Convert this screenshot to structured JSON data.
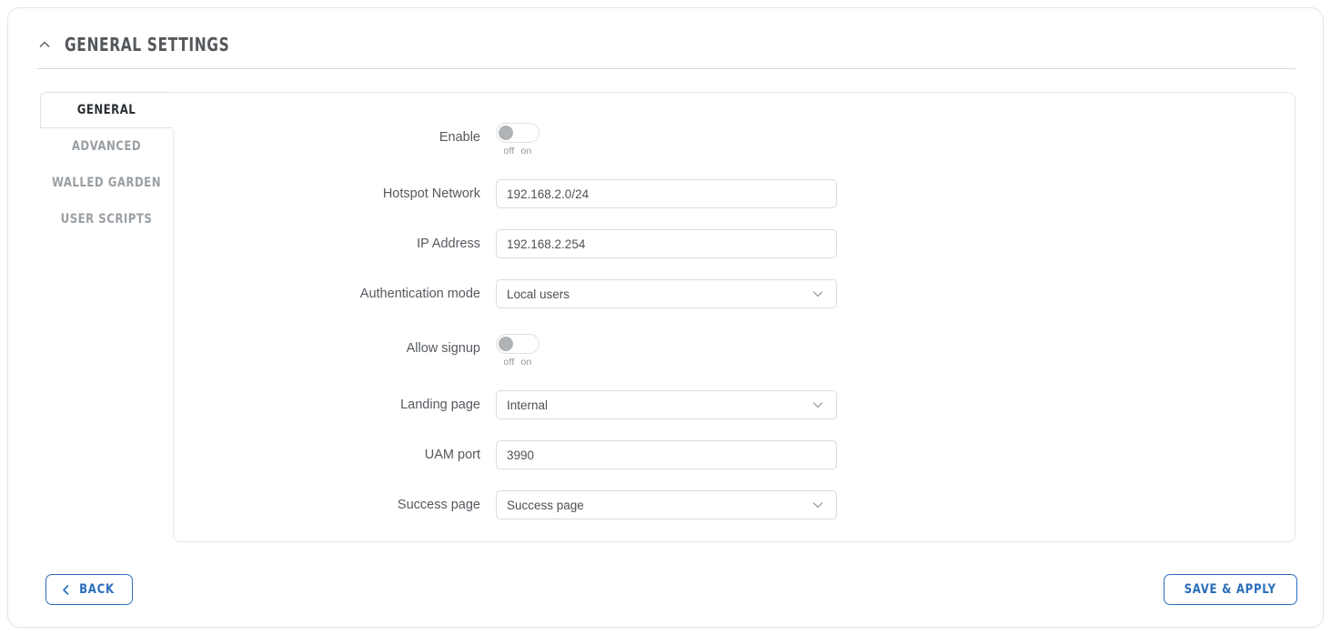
{
  "section": {
    "title": "GENERAL SETTINGS",
    "collapse_icon": "chevron-up-icon",
    "collapsed": false
  },
  "tabs": [
    {
      "label": "GENERAL",
      "active": true
    },
    {
      "label": "ADVANCED",
      "active": false
    },
    {
      "label": "WALLED GARDEN",
      "active": false
    },
    {
      "label": "USER SCRIPTS",
      "active": false
    }
  ],
  "form": {
    "enable": {
      "label": "Enable",
      "type": "toggle",
      "state": "off",
      "off_label": "off",
      "on_label": "on"
    },
    "hotspot_network": {
      "label": "Hotspot Network",
      "type": "text",
      "value": "192.168.2.0/24",
      "placeholder": ""
    },
    "ip_address": {
      "label": "IP Address",
      "type": "text",
      "value": "192.168.2.254",
      "placeholder": ""
    },
    "authentication_mode": {
      "label": "Authentication mode",
      "type": "select",
      "value": "Local users",
      "icon": "chevron-down-icon"
    },
    "allow_signup": {
      "label": "Allow signup",
      "type": "toggle",
      "state": "off",
      "off_label": "off",
      "on_label": "on"
    },
    "landing_page": {
      "label": "Landing page",
      "type": "select",
      "value": "Internal",
      "icon": "chevron-down-icon"
    },
    "uam_port": {
      "label": "UAM port",
      "type": "text",
      "value": "3990",
      "placeholder": ""
    },
    "success_page": {
      "label": "Success page",
      "type": "select",
      "value": "Success page",
      "icon": "chevron-down-icon"
    }
  },
  "footer": {
    "back_label": "BACK",
    "back_icon": "chevron-left-icon",
    "save_label": "SAVE & APPLY"
  },
  "colors": {
    "accent": "#2a6ebb",
    "label_text": "#55595e",
    "muted_text": "#9a9fa4",
    "border": "#dcdcdc",
    "toggle_knob": "#b0b3b6"
  }
}
